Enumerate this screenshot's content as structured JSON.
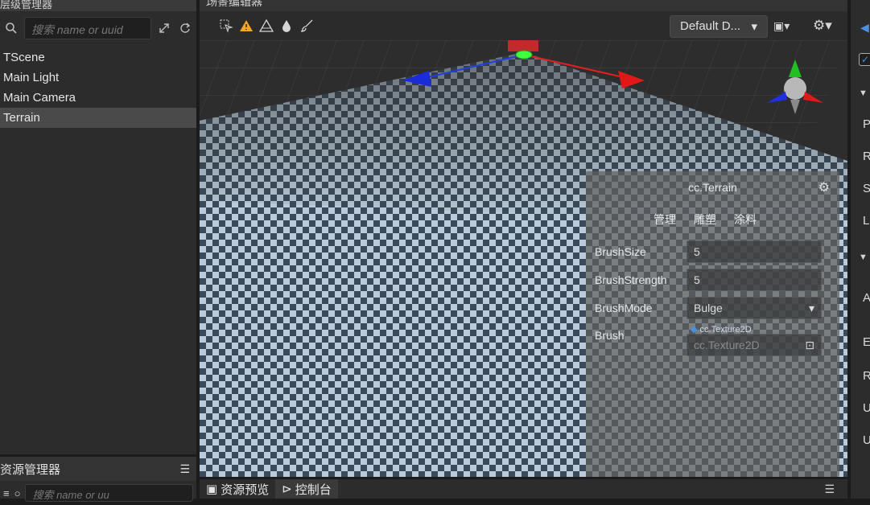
{
  "hierarchy": {
    "tab_title": "层级管理器",
    "search_placeholder": "搜索 name or uuid",
    "items": [
      {
        "label": "TScene"
      },
      {
        "label": "Main Light"
      },
      {
        "label": "Main Camera"
      },
      {
        "label": "Terrain"
      }
    ]
  },
  "assets": {
    "tab_title": "资源管理器",
    "search_placeholder": "搜索 name or uu"
  },
  "scene": {
    "tab_title": "场景编辑器",
    "camera_select": "Default D...",
    "bottom_tabs": [
      "资源预览",
      "控制台"
    ]
  },
  "terrain_panel": {
    "title": "cc.Terrain",
    "tabs": [
      "管理",
      "雕塑",
      "涂料"
    ],
    "brush_size_label": "BrushSize",
    "brush_size": "5",
    "brush_strength_label": "BrushStrength",
    "brush_strength": "5",
    "brush_mode_label": "BrushMode",
    "brush_mode": "Bulge",
    "brush_label": "Brush",
    "brush_type": "cc.Texture2D",
    "brush_value": "cc.Texture2D"
  },
  "inspector": {
    "letters": [
      "P",
      "R",
      "S",
      "L",
      "A",
      "E",
      "R",
      "U",
      "U"
    ]
  },
  "colors": {
    "accent": "#4a90e2",
    "warning": "#f5a623",
    "checker_light": "#b9cbd8",
    "checker_dark": "#3b4a5a"
  }
}
